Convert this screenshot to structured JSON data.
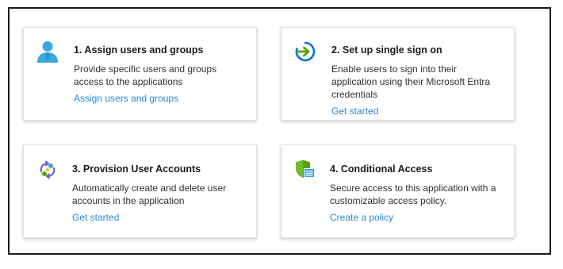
{
  "cards": [
    {
      "title": "1. Assign users and groups",
      "description": "Provide specific users and groups access to the applications",
      "link": "Assign users and groups",
      "icon": "user-icon"
    },
    {
      "title": "2. Set up single sign on",
      "description": "Enable users to sign into their application using their Microsoft Entra credentials",
      "link": "Get started",
      "icon": "sign-in-arrow-icon"
    },
    {
      "title": "3. Provision User Accounts",
      "description": "Automatically create and delete user accounts in the application",
      "link": "Get started",
      "icon": "sync-cycle-icon"
    },
    {
      "title": "4. Conditional Access",
      "description": "Secure access to this application with a customizable access policy.",
      "link": "Create a policy",
      "icon": "shield-policy-icon"
    }
  ],
  "colors": {
    "link": "#2b88d8",
    "title": "#1b1b1b",
    "text": "#323130",
    "user_icon": "#3aa7e0",
    "arrow_icon": "#0078d4",
    "shield_icon": "#57a300"
  }
}
